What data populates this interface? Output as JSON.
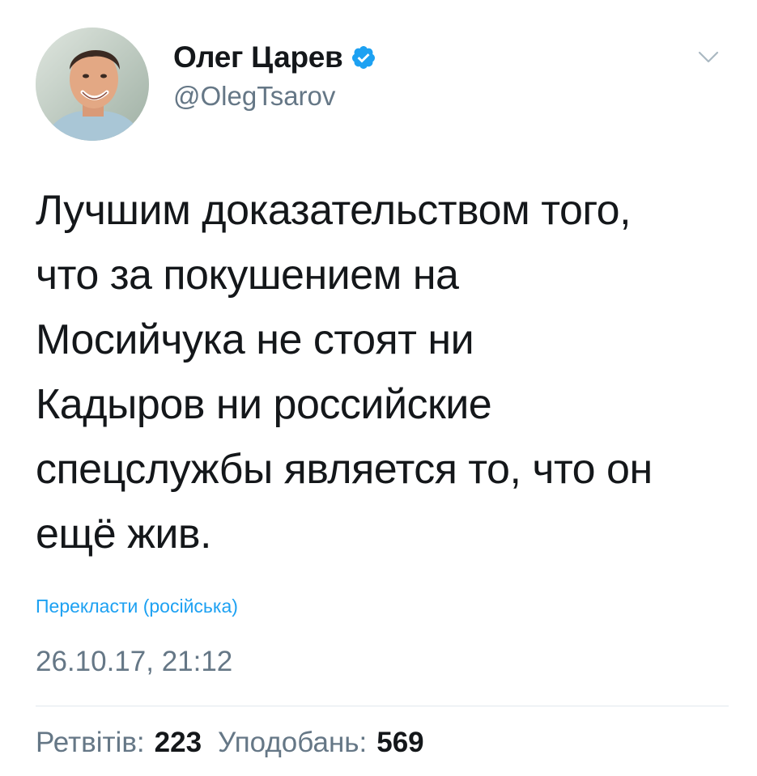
{
  "author": {
    "display_name": "Олег Царев",
    "handle": "@OlegTsarov",
    "verified": true,
    "avatar_icon": "profile-photo"
  },
  "tweet": {
    "text_lines": [
      "Лучшим доказательством того,",
      "что за покушением на",
      "Мосийчука не стоят ни",
      "Кадыров ни российские",
      "спецслужбы является то, что он",
      "ещё жив."
    ],
    "translate_label": "Перекласти (російська)",
    "timestamp": "26.10.17, 21:12"
  },
  "stats": {
    "retweets_label": "Ретвітів:",
    "retweets_count": "223",
    "likes_label": "Уподобань:",
    "likes_count": "569"
  },
  "colors": {
    "text": "#14171a",
    "secondary": "#657786",
    "link": "#1da1f2",
    "verified": "#1da1f2",
    "divider": "#e1e8ed"
  },
  "icons": {
    "verified": "verified-badge-icon",
    "menu": "chevron-down-icon"
  }
}
